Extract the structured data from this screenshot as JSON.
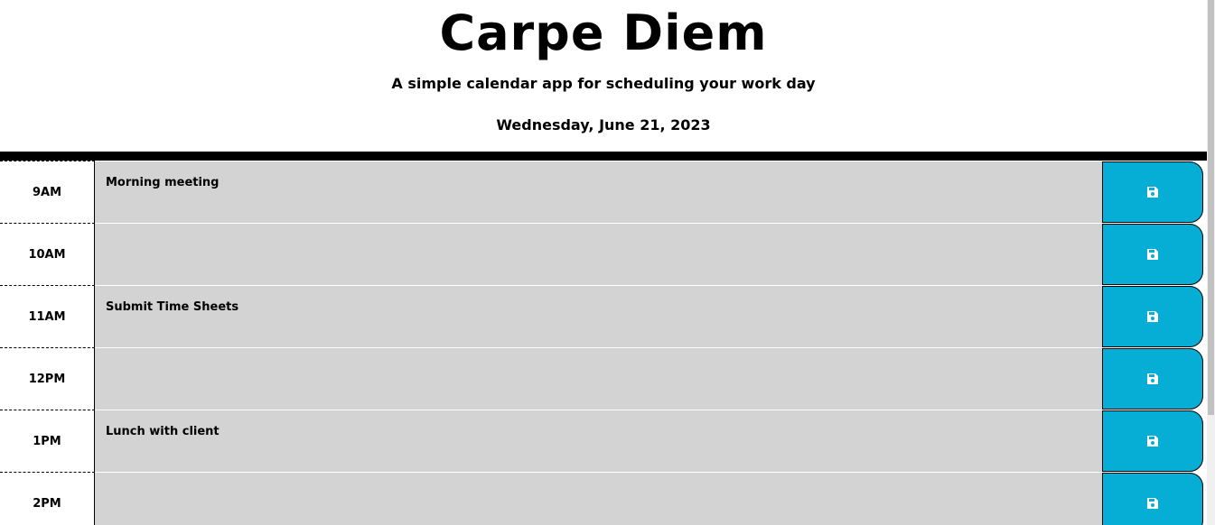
{
  "header": {
    "title": "Carpe Diem",
    "subtitle": "A simple calendar app for scheduling your work day",
    "current_day": "Wednesday, June 21, 2023"
  },
  "timeblocks": [
    {
      "hour": "9AM",
      "description": "Morning meeting",
      "save_icon": "floppy-disk-icon"
    },
    {
      "hour": "10AM",
      "description": "",
      "save_icon": "floppy-disk-icon"
    },
    {
      "hour": "11AM",
      "description": "Submit Time Sheets",
      "save_icon": "floppy-disk-icon"
    },
    {
      "hour": "12PM",
      "description": "",
      "save_icon": "floppy-disk-icon"
    },
    {
      "hour": "1PM",
      "description": "Lunch with client",
      "save_icon": "floppy-disk-icon"
    },
    {
      "hour": "2PM",
      "description": "",
      "save_icon": "floppy-disk-icon"
    }
  ],
  "colors": {
    "past_block": "#d3d3d3",
    "save_button": "#06aed5",
    "divider": "#000000"
  }
}
